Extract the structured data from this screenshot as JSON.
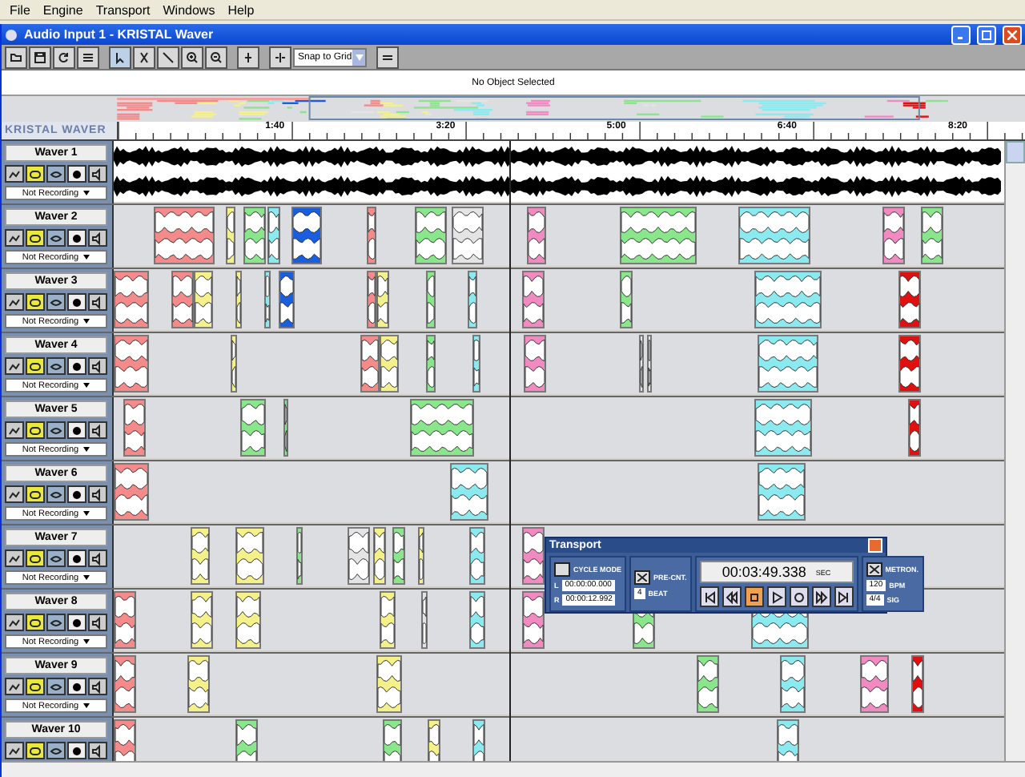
{
  "menu": [
    "File",
    "Engine",
    "Transport",
    "Windows",
    "Help"
  ],
  "window": {
    "title": "Audio Input 1 - KRISTAL Waver"
  },
  "toolbar": {
    "snap": "Snap to Grid"
  },
  "info": "No Object Selected",
  "logo": "KRISTAL WAVER",
  "ruler": [
    "1:40",
    "3:20",
    "5:00",
    "6:40",
    "8:20"
  ],
  "tracks": [
    {
      "name": "Waver 1",
      "record_mode": "Not Recording"
    },
    {
      "name": "Waver 2",
      "record_mode": "Not Recording"
    },
    {
      "name": "Waver 3",
      "record_mode": "Not Recording"
    },
    {
      "name": "Waver 4",
      "record_mode": "Not Recording"
    },
    {
      "name": "Waver 5",
      "record_mode": "Not Recording"
    },
    {
      "name": "Waver 6",
      "record_mode": "Not Recording"
    },
    {
      "name": "Waver 7",
      "record_mode": "Not Recording"
    },
    {
      "name": "Waver 8",
      "record_mode": "Not Recording"
    },
    {
      "name": "Waver 9",
      "record_mode": "Not Recording"
    },
    {
      "name": "Waver 10"
    }
  ],
  "transport": {
    "title": "Transport",
    "cycle_label": "CYCLE MODE",
    "left_label": "L",
    "left": "00:00:00.000",
    "right_label": "R",
    "right": "00:00:12.992",
    "precount_label": "PRE-CNT.",
    "precount_checked": true,
    "metronome_checked": true,
    "beats": "4",
    "beats_unit": "BEAT",
    "time": "00:03:49.338",
    "time_unit": "SEC",
    "buttons": [
      {
        "kind": "start",
        "selected": false
      },
      {
        "kind": "rewind",
        "selected": false
      },
      {
        "kind": "stop",
        "selected": true
      },
      {
        "kind": "play",
        "selected": false
      },
      {
        "kind": "record",
        "selected": false
      },
      {
        "kind": "forward",
        "selected": false
      },
      {
        "kind": "end",
        "selected": false
      }
    ],
    "metronome_label": "METRON.",
    "tempo": "120",
    "tempo_unit": "BPM",
    "signature": "4/4",
    "signature_unit": "SIG"
  }
}
